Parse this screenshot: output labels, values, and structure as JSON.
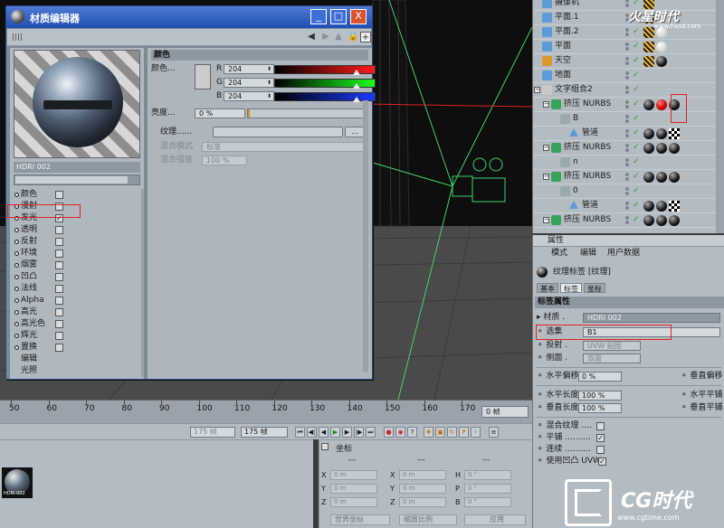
{
  "colors": {
    "accent": "#1f4fb3",
    "highlight_box": "#e52020",
    "panel": "#b4bcc3",
    "viewport": "#4a4a4a"
  },
  "material_editor": {
    "title": "材质编辑器",
    "window_buttons": [
      "_",
      "□",
      "X"
    ],
    "material_name": "HDRI 002",
    "channels": [
      {
        "label": "颜色",
        "dots": "...",
        "checked": false
      },
      {
        "label": "漫射",
        "dots": "",
        "checked": false
      },
      {
        "label": "发光",
        "dots": "",
        "checked": true
      },
      {
        "label": "透明",
        "dots": "",
        "checked": false
      },
      {
        "label": "反射",
        "dots": "",
        "checked": false
      },
      {
        "label": "环境",
        "dots": "",
        "checked": false
      },
      {
        "label": "烟雾",
        "dots": "",
        "checked": false
      },
      {
        "label": "凹凸",
        "dots": "",
        "checked": false
      },
      {
        "label": "法线",
        "dots": "",
        "checked": false
      },
      {
        "label": "Alpha",
        "dots": "",
        "checked": false
      },
      {
        "label": "高光",
        "dots": "",
        "checked": false
      },
      {
        "label": "高光色",
        "dots": "",
        "checked": false
      },
      {
        "label": "辉光",
        "dots": "",
        "checked": false
      },
      {
        "label": "置换",
        "dots": "",
        "checked": false
      },
      {
        "label": "编辑",
        "dots": "",
        "checked": null
      },
      {
        "label": "光照",
        "dots": "",
        "checked": null
      }
    ],
    "section_title": "颜色",
    "color_label": "颜色...",
    "rgb": [
      {
        "channel": "R",
        "value": "204",
        "fraction": 0.8
      },
      {
        "channel": "G",
        "value": "204",
        "fraction": 0.8
      },
      {
        "channel": "B",
        "value": "204",
        "fraction": 0.8
      }
    ],
    "brightness_label": "亮度...",
    "brightness_value": "0 %",
    "texture_label": "纹理......",
    "blend_mode_label": "混合模式",
    "blend_mode_value": "标准",
    "blend_strength_label": "混合强度",
    "blend_strength_value": "100 %"
  },
  "object_manager": {
    "items": [
      {
        "name": "摄像机",
        "indent": 0,
        "tags": []
      },
      {
        "name": "平面.1",
        "indent": 0,
        "tags": [
          "white"
        ]
      },
      {
        "name": "平面.2",
        "indent": 0,
        "tags": [
          "white"
        ]
      },
      {
        "name": "平面",
        "indent": 0,
        "tags": [
          "white"
        ]
      },
      {
        "name": "天空",
        "indent": 0,
        "tags": [
          "ball"
        ]
      },
      {
        "name": "地面",
        "indent": 0,
        "tags": []
      },
      {
        "name": "文字组合2",
        "indent": 0,
        "tags": []
      },
      {
        "name": "挤压 NURBS",
        "indent": 1,
        "tags": [
          "ball",
          "red",
          "ball"
        ]
      },
      {
        "name": "B",
        "indent": 2,
        "tags": []
      },
      {
        "name": "管道",
        "indent": 3,
        "tags": [
          "ball",
          "ball",
          "check"
        ]
      },
      {
        "name": "挤压 NURBS",
        "indent": 1,
        "tags": [
          "ball",
          "ball",
          "ball"
        ]
      },
      {
        "name": "n",
        "indent": 2,
        "tags": []
      },
      {
        "name": "挤压 NURBS",
        "indent": 1,
        "tags": [
          "ball",
          "ball",
          "ball"
        ]
      },
      {
        "name": "0",
        "indent": 2,
        "tags": []
      },
      {
        "name": "管道",
        "indent": 3,
        "tags": [
          "ball",
          "ball",
          "check"
        ]
      },
      {
        "name": "挤压 NURBS",
        "indent": 1,
        "tags": [
          "ball",
          "ball",
          "ball"
        ]
      }
    ],
    "watermark": "火星时代",
    "watermark_url": "www.hxsd.com"
  },
  "attributes": {
    "header": "属性",
    "menu": [
      "模式",
      "编辑",
      "用户数据"
    ],
    "tag_title": "纹理标签 [纹理]",
    "tabs": [
      "基本",
      "标签",
      "坐标"
    ],
    "active_tab": "标签",
    "section": "标签属性",
    "material_label": "材质",
    "material_value": "HDRI 002",
    "selection_label": "选集",
    "selection_value": "B1",
    "projection_label": "投射",
    "projection_value": "UVW 贴图",
    "side_label": "侧面",
    "side_value": "双面",
    "offset_u_label": "水平偏移",
    "offset_u_value": "0 %",
    "offset_v_label": "垂直偏移",
    "length_u_label": "水平长度",
    "length_u_value": "100 %",
    "tiles_u_label": "水平平铺",
    "length_v_label": "垂直长度",
    "length_v_value": "100 %",
    "tiles_v_label": "垂直平铺",
    "mix_label": "混合纹理",
    "mix_checked": false,
    "tile_label": "平铺",
    "tile_checked": true,
    "seamless_label": "连续",
    "seamless_checked": false,
    "bump_uvw_label": "使用凹凸 UVW",
    "bump_uvw_checked": true
  },
  "timeline": {
    "ticks": [
      "50",
      "60",
      "70",
      "80",
      "90",
      "100",
      "110",
      "120",
      "130",
      "140",
      "150",
      "160",
      "170"
    ],
    "frame": "0 帧",
    "start_frame": "175 帧",
    "end_frame": "175 帧"
  },
  "material_bin": {
    "thumb_label": "HDRI 002"
  },
  "coordinates": {
    "title": "坐标",
    "columns": [
      "---",
      "---",
      "---"
    ],
    "rows": [
      {
        "axis": "X",
        "value": "0 m",
        "axis2": "X",
        "value2": "0 m",
        "axis3": "H",
        "value3": "0 °"
      },
      {
        "axis": "Y",
        "value": "0 m",
        "axis2": "Y",
        "value2": "0 m",
        "axis3": "P",
        "value3": "0 °"
      },
      {
        "axis": "Z",
        "value": "0 m",
        "axis2": "Z",
        "value2": "0 m",
        "axis3": "B",
        "value3": "0 °"
      }
    ],
    "world_label": "世界坐标",
    "scale_label": "缩放比例",
    "apply_label": "应用"
  },
  "cg_logo": {
    "text": "CG时代",
    "url": "www.cgtime.com"
  }
}
